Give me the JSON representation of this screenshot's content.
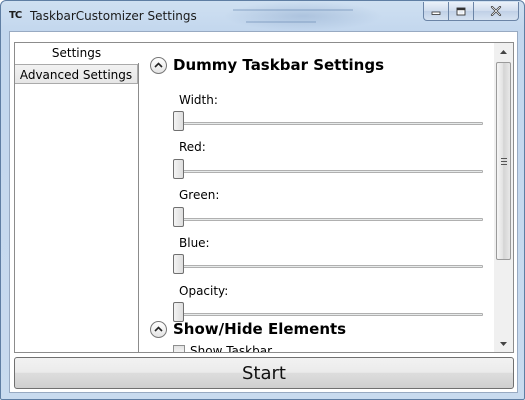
{
  "window": {
    "title": "TaskbarCustomizer Settings",
    "icon_text": "TC"
  },
  "tabs": [
    {
      "label": "Settings",
      "selected": true
    },
    {
      "label": "Advanced Settings",
      "selected": false
    }
  ],
  "sections": {
    "dummy_taskbar": {
      "title": "Dummy Taskbar Settings",
      "expanded": true,
      "sliders": [
        {
          "label": "Width:",
          "value": 0
        },
        {
          "label": "Red:",
          "value": 0
        },
        {
          "label": "Green:",
          "value": 0
        },
        {
          "label": "Blue:",
          "value": 0
        },
        {
          "label": "Opacity:",
          "value": 0
        }
      ]
    },
    "show_hide": {
      "title": "Show/Hide Elements",
      "expanded": true,
      "first_checkbox": {
        "label": "Show Taskbar",
        "checked": false
      }
    }
  },
  "buttons": {
    "start": "Start"
  },
  "icons": {
    "minimize": "minimize-icon",
    "maximize": "maximize-icon",
    "close": "close-icon",
    "collapse": "chevron-up-icon",
    "scroll_up": "scroll-up-arrow-icon",
    "scroll_down": "scroll-down-arrow-icon"
  }
}
